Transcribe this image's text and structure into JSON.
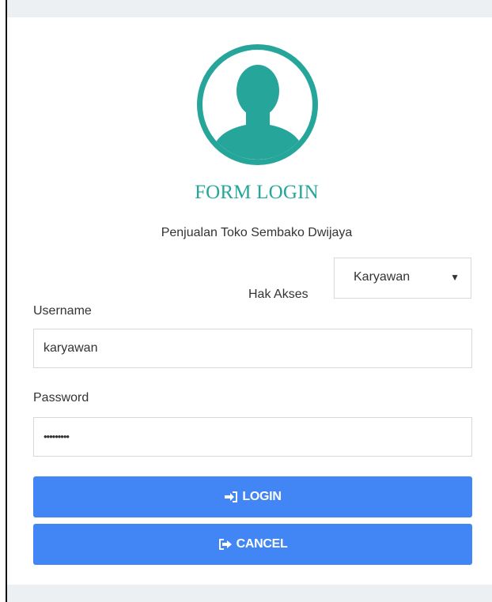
{
  "form": {
    "title": "FORM LOGIN",
    "subtitle": "Penjualan Toko Sembako Dwijaya",
    "accent_color": "#26a69a",
    "button_color": "#4285f4"
  },
  "access": {
    "label": "Hak Akses",
    "selected": "Karyawan",
    "arrow": "▼"
  },
  "username": {
    "label": "Username",
    "value": "karyawan"
  },
  "password": {
    "label": "Password",
    "value": "•••••••••"
  },
  "buttons": {
    "login_label": "LOGIN",
    "login_icon": "sign-in-icon",
    "cancel_label": "CANCEL",
    "cancel_icon": "sign-out-icon"
  }
}
